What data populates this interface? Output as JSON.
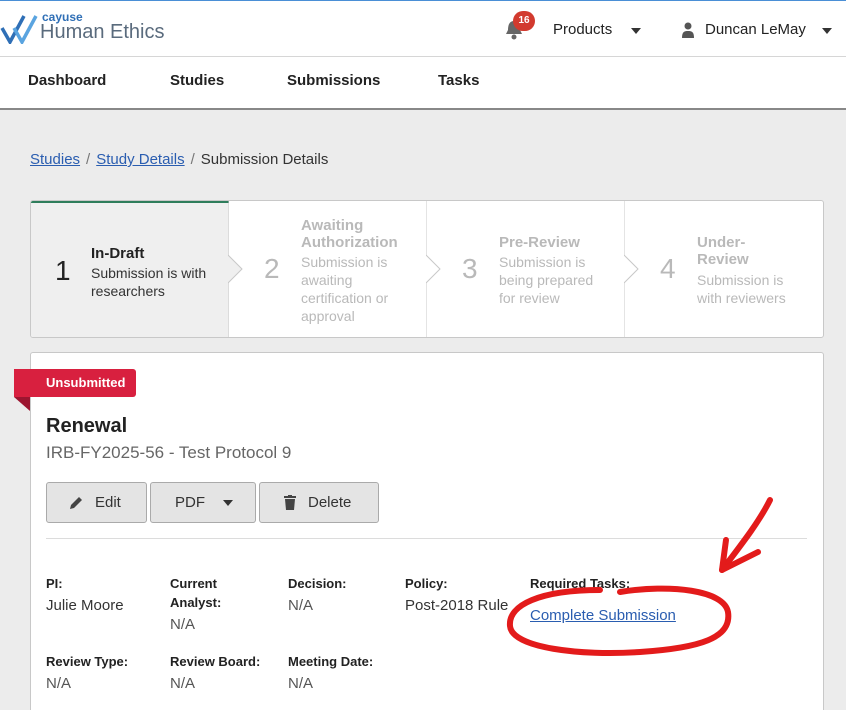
{
  "header": {
    "logo_small": "cayuse",
    "logo_big": "Human Ethics",
    "notification_count": "16",
    "products_label": "Products",
    "user_name": "Duncan LeMay"
  },
  "nav": {
    "items": [
      "Dashboard",
      "Studies",
      "Submissions",
      "Tasks"
    ]
  },
  "breadcrumb": {
    "items": [
      "Studies",
      "Study Details",
      "Submission Details"
    ],
    "separator": "/"
  },
  "steps": [
    {
      "number": "1",
      "title": "In-Draft",
      "description": "Submission is with researchers",
      "active": true
    },
    {
      "number": "2",
      "title": "Awaiting Authorization",
      "description": "Submission is awaiting certification or approval",
      "active": false
    },
    {
      "number": "3",
      "title": "Pre-Review",
      "description": "Submission is being prepared for review",
      "active": false
    },
    {
      "number": "4",
      "title": "Under-Review",
      "description": "Submission is with reviewers",
      "active": false
    }
  ],
  "submission": {
    "status": "Unsubmitted",
    "title": "Renewal",
    "subtitle": "IRB-FY2025-56 - Test Protocol 9",
    "buttons": {
      "edit": "Edit",
      "pdf": "PDF",
      "delete": "Delete"
    },
    "fields": {
      "pi": {
        "label": "PI:",
        "value": "Julie Moore"
      },
      "current_analyst": {
        "label": "Current Analyst:",
        "value": "N/A"
      },
      "decision": {
        "label": "Decision:",
        "value": "N/A"
      },
      "policy": {
        "label": "Policy:",
        "value": "Post-2018 Rule"
      },
      "required_tasks": {
        "label": "Required Tasks:",
        "value": "Complete Submission"
      },
      "review_type": {
        "label": "Review Type:",
        "value": "N/A"
      },
      "review_board": {
        "label": "Review Board:",
        "value": "N/A"
      },
      "meeting_date": {
        "label": "Meeting Date:",
        "value": "N/A"
      }
    }
  },
  "colors": {
    "status_ribbon": "#d8203f",
    "link": "#2a5db0",
    "active_step_bar": "#2e7d5b",
    "annotation": "#e31b1b"
  },
  "icons": [
    "bell-icon",
    "caret-down-icon",
    "user-icon",
    "pencil-icon",
    "trash-icon"
  ]
}
